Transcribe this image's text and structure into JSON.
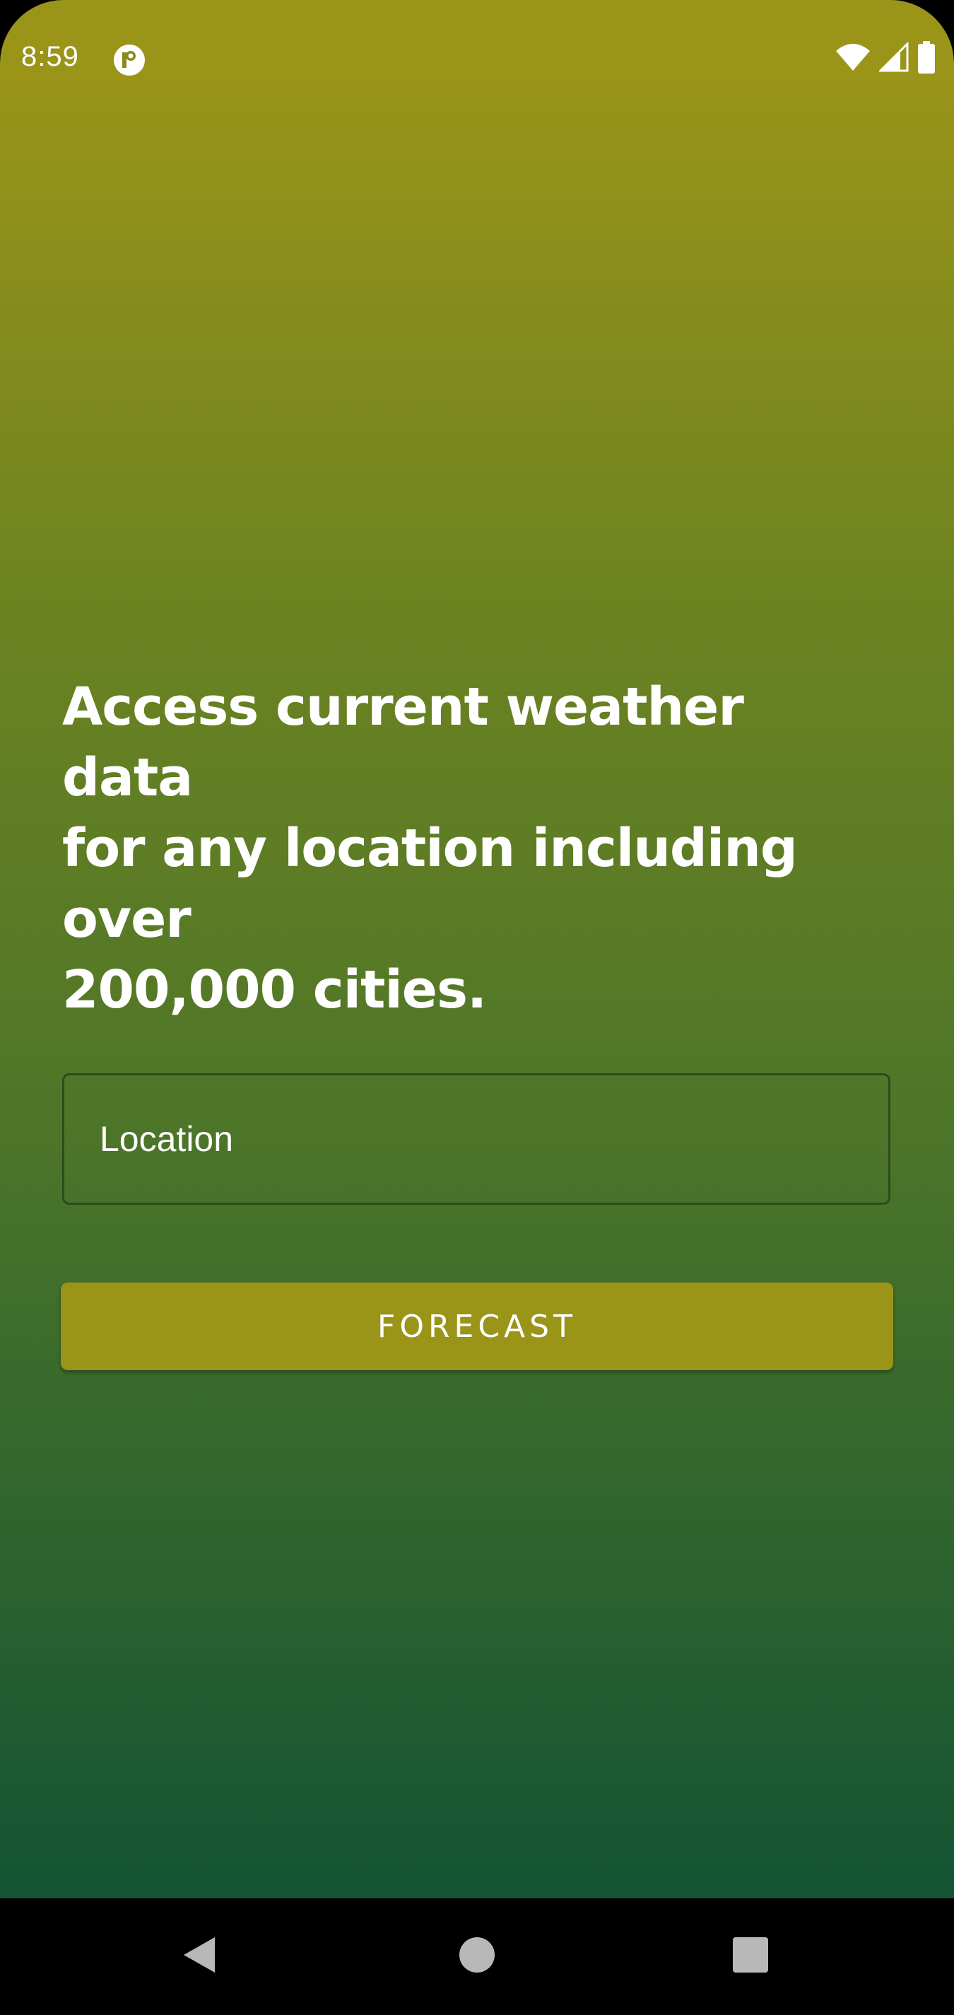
{
  "status_bar": {
    "time": "8:59",
    "app_icon": "notification-app-icon",
    "icons": [
      "wifi-icon",
      "cell-signal-icon",
      "battery-icon"
    ]
  },
  "headline": {
    "line1": "Access current weather data",
    "line2": "for any location including over",
    "line3": "200,000 cities."
  },
  "location": {
    "placeholder": "Location",
    "value": ""
  },
  "forecast_button": {
    "label": "FORECAST"
  },
  "nav_bar": {
    "icons": [
      "back-icon",
      "home-icon",
      "recents-icon"
    ]
  },
  "colors": {
    "gradient_top": "#9a9419",
    "gradient_bottom": "#135433",
    "button": "#9a9419",
    "text": "#ffffff"
  }
}
